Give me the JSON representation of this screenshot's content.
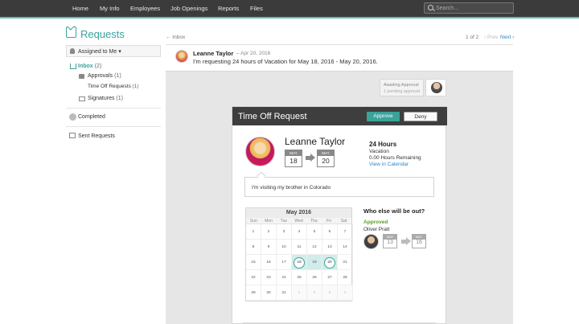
{
  "nav": {
    "items": [
      "Home",
      "My Info",
      "Employees",
      "Job Openings",
      "Reports",
      "Files"
    ],
    "search_placeholder": "Search..."
  },
  "sidebar": {
    "title": "Requests",
    "filter_label": "Assigned to Me",
    "inbox_label": "Inbox",
    "inbox_count": "(2)",
    "approvals_label": "Approvals",
    "approvals_count": "(1)",
    "time_off_label": "Time Off Requests",
    "time_off_count": "(1)",
    "signatures_label": "Signatures",
    "signatures_count": "(1)",
    "completed_label": "Completed",
    "sent_label": "Sent Requests"
  },
  "main": {
    "back_label": "← Inbox",
    "pager_text": "1 of 2",
    "prev_label": "‹ Prev",
    "next_label": "Next ›",
    "requester_name": "Leanne Taylor",
    "request_date": "– Apr 20, 2016",
    "request_message": "I'm requesting 24 hours of Vacation for May 18, 2016 - May 20, 2016.",
    "await_title": "Awaiting Approval",
    "await_sub": "1 pending approval"
  },
  "card": {
    "title": "Time Off Request",
    "approve_label": "Approve",
    "deny_label": "Deny",
    "employee_name": "Leanne Taylor",
    "start": {
      "month": "MAY",
      "day": "18"
    },
    "end": {
      "month": "MAY",
      "day": "20"
    },
    "hours": "24 Hours",
    "type": "Vacation",
    "remaining": "0.00 Hours Remaining",
    "calendar_link": "View in Calendar",
    "comment": "I'm visiting my brother in Colorado"
  },
  "calendar": {
    "month": "May 2016",
    "dows": [
      "Sun",
      "Mon",
      "Tue",
      "Wed",
      "Thu",
      "Fri",
      "Sat"
    ],
    "days": [
      "1",
      "2",
      "3",
      "4",
      "5",
      "6",
      "7",
      "8",
      "9",
      "10",
      "11",
      "12",
      "13",
      "14",
      "15",
      "16",
      "17",
      "18",
      "19",
      "20",
      "21",
      "22",
      "23",
      "24",
      "25",
      "26",
      "27",
      "28",
      "29",
      "30",
      "31",
      "1",
      "2",
      "3",
      "4"
    ],
    "other_month_from_index": 31,
    "selected_days": [
      "18",
      "20"
    ],
    "range_days": [
      "19"
    ]
  },
  "who_else": {
    "title": "Who else will be out?",
    "status": "Approved",
    "name": "Oliver Pratt",
    "start": {
      "month": "MAY",
      "day": "13"
    },
    "end": {
      "month": "MAY",
      "day": "16"
    }
  },
  "colors": {
    "accent": "#3aa39a",
    "nav_bg": "#3b3b3b",
    "link": "#2a86c9"
  }
}
